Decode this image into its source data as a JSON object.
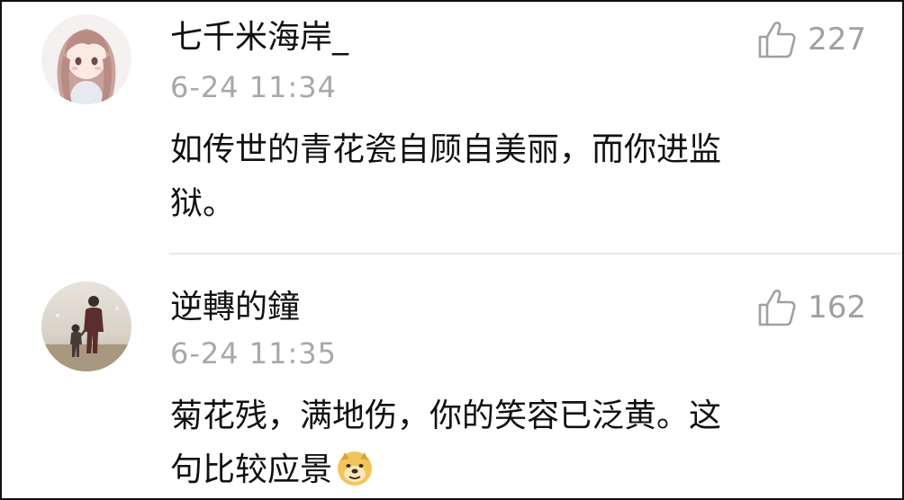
{
  "comments": [
    {
      "username": "七千米海岸_",
      "timestamp": "6-24 11:34",
      "likes": "227",
      "text_line1": "如传世的青花瓷自顾自美丽，而你进监",
      "text_line2": "狱。",
      "avatar_icon": "anime-girl-avatar",
      "like_icon": "thumbs-up-icon"
    },
    {
      "username": "逆轉的鐘",
      "timestamp": "6-24 11:35",
      "likes": "162",
      "text_line1": "菊花残，满地伤，你的笑容已泛黄。这",
      "text_line2": "句比较应景",
      "avatar_icon": "father-child-photo-avatar",
      "like_icon": "thumbs-up-icon",
      "trailing_emoji": "doge-emoji-icon"
    }
  ],
  "colors": {
    "text": "#111111",
    "meta": "#a8a8a8",
    "like": "#a0a0a0",
    "divider": "#e8e8e8"
  }
}
